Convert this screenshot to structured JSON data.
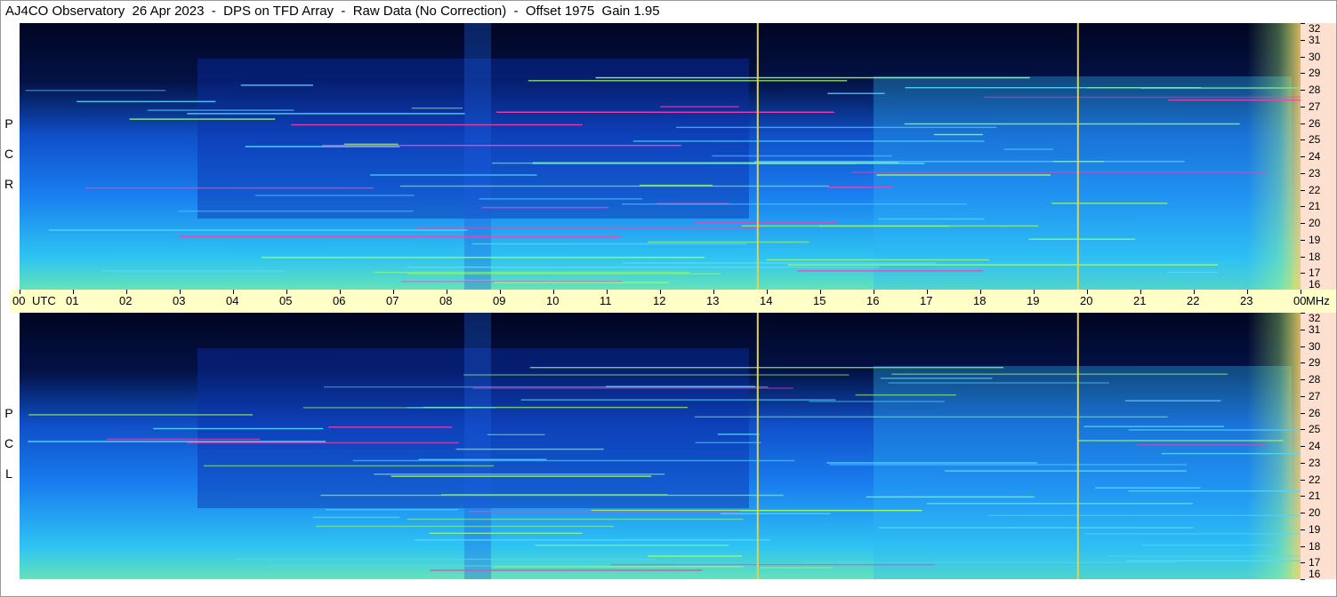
{
  "title": "AJ4CO Observatory  26 Apr 2023  -  DPS on TFD Array  -  Raw Data (No Correction)  -  Offset 1975  Gain 1.95",
  "colors": {
    "background_dark": "#000522",
    "spectrum_mid": "#1b6fe8",
    "spectrum_bright": "#5fe0ff",
    "interference": "#ff3cb0",
    "marker_line": "#e6d24a",
    "time_strip": "#ffffc7",
    "freq_axis": "#fde0cf"
  },
  "chart_data": {
    "type": "heatmap",
    "title": "AJ4CO Observatory  26 Apr 2023  -  DPS on TFD Array  -  Raw Data (No Correction)  -  Offset 1975  Gain 1.95",
    "x_axis": {
      "unit_label": "UTC",
      "ticks": [
        "00",
        "01",
        "02",
        "03",
        "04",
        "05",
        "06",
        "07",
        "08",
        "09",
        "10",
        "11",
        "12",
        "13",
        "14",
        "15",
        "16",
        "17",
        "18",
        "19",
        "20",
        "21",
        "22",
        "23",
        "00"
      ],
      "range_hours": [
        0,
        24
      ]
    },
    "y_axis": {
      "unit_label": "MHz",
      "ticks": [
        16,
        17,
        18,
        19,
        20,
        21,
        22,
        23,
        24,
        25,
        26,
        27,
        28,
        29,
        30,
        31,
        32
      ],
      "range": [
        16,
        32
      ]
    },
    "panels": [
      {
        "name": "R C P",
        "letters": [
          "R",
          "C",
          "P"
        ]
      },
      {
        "name": "L C P",
        "letters": [
          "L",
          "C",
          "P"
        ]
      }
    ],
    "markers_hours": [
      13.83,
      19.83
    ]
  }
}
